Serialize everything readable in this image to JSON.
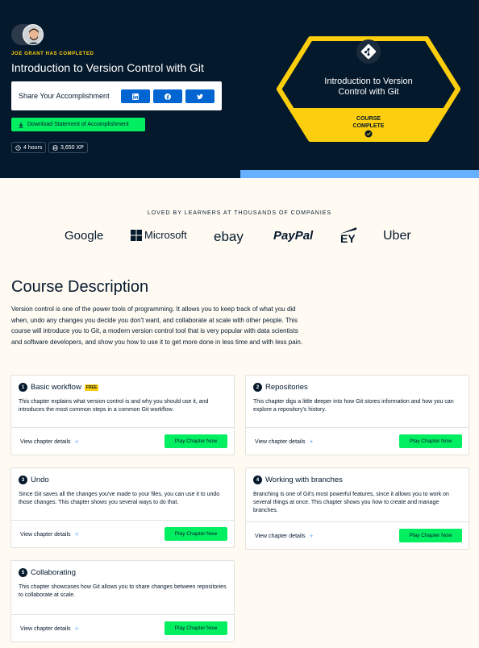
{
  "hero": {
    "completed_label": "JOE GRANT HAS COMPLETED",
    "course_title": "Introduction to Version Control with Git",
    "share_label": "Share Your Accomplishment",
    "download_label": "Download Statement of Accomplishment",
    "hours": "4 hours",
    "xp": "3,650 XP"
  },
  "badge": {
    "title_line1": "Introduction to Version",
    "title_line2": "Control with Git",
    "status_line1": "COURSE",
    "status_line2": "COMPLETE"
  },
  "logos": {
    "heading": "LOVED BY LEARNERS AT THOUSANDS OF COMPANIES",
    "items": [
      "Google",
      "Microsoft",
      "ebay",
      "PayPal",
      "EY",
      "Uber"
    ]
  },
  "description": {
    "title": "Course Description",
    "text": "Version control is one of the power tools of programming. It allows you to keep track of what you did when, undo any changes you decide you don't want, and collaborate at scale with other people. This course will introduce you to Git, a modern version control tool that is very popular with data scientists and software developers, and show you how to use it to get more done in less time and with less pain."
  },
  "chapters": [
    {
      "num": "1",
      "title": "Basic workflow",
      "free": "FREE",
      "body": "This chapter explains what version control is and why you should use it, and introduces the most common steps in a common Git workflow.",
      "details": "View chapter details",
      "play": "Play Chapter Now"
    },
    {
      "num": "2",
      "title": "Repositories",
      "body": "This chapter digs a little deeper into how Git stores information and how you can explore a repository's history.",
      "details": "View chapter details",
      "play": "Play Chapter Now"
    },
    {
      "num": "3",
      "title": "Undo",
      "body": "Since Git saves all the changes you've made to your files, you can use it to undo those changes. This chapter shows you several ways to do that.",
      "details": "View chapter details",
      "play": "Play Chapter Now"
    },
    {
      "num": "4",
      "title": "Working with branches",
      "body": "Branching is one of Git's most powerful features, since it allows you to work on several things at once. This chapter shows you how to create and manage branches.",
      "details": "View chapter details",
      "play": "Play Chapter Now"
    },
    {
      "num": "5",
      "title": "Collaborating",
      "body": "This chapter showcases how Git allows you to share changes between repositories to collaborate at scale.",
      "details": "View chapter details",
      "play": "Play Chapter Now"
    }
  ],
  "colors": {
    "navy": "#05192d",
    "green": "#03ef62",
    "yellow": "#fcce0d",
    "blue": "#0065d1",
    "light_blue": "#65b0ff",
    "cream": "#fffbf3"
  }
}
